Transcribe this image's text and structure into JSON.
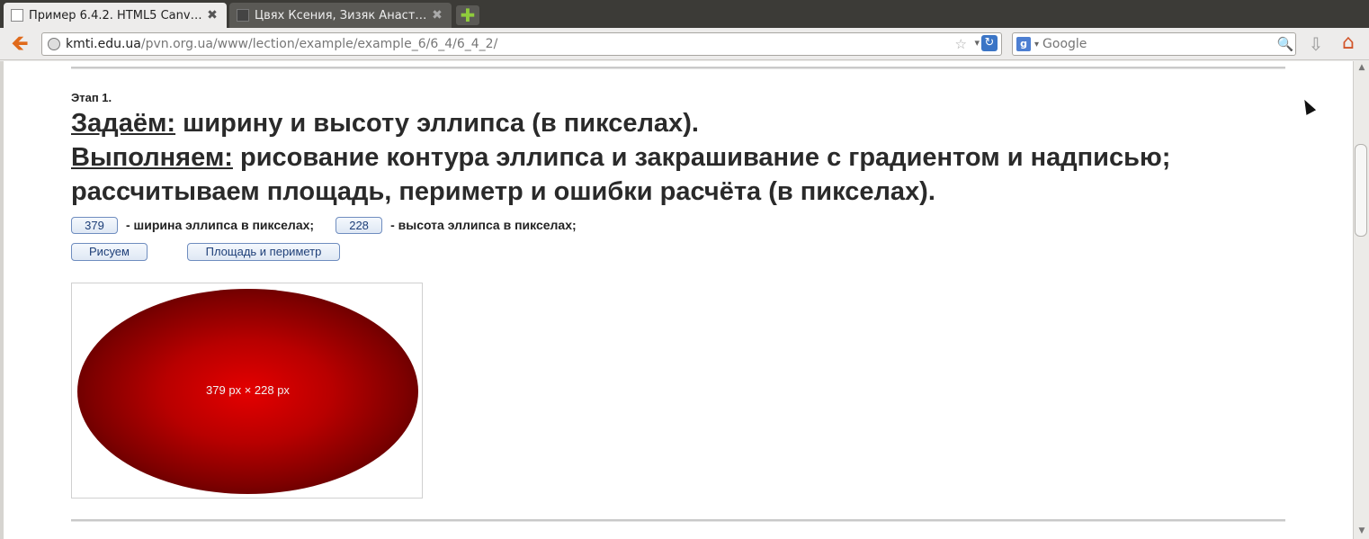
{
  "browser": {
    "tabs": [
      {
        "title": "Пример 6.4.2. HTML5 Canv…",
        "close": "✖"
      },
      {
        "title": "Цвях Ксения, Зизяк Анаст…",
        "close": "✖"
      }
    ],
    "new_tab": "✚",
    "back_icon": "🡸",
    "url": {
      "host": "kmti.edu.ua",
      "path": "/pvn.org.ua/www/lection/example/example_6/6_4/6_4_2/"
    },
    "bookmark_icon": "☆",
    "url_dropdown_icon": "▾",
    "reload_icon": "↻",
    "search": {
      "engine": "g",
      "engine_dropdown": "▾",
      "placeholder": "Google",
      "go_icon": "🔍"
    },
    "download_icon": "⇩",
    "home_icon": "⌂",
    "scroll_up": "▲",
    "scroll_down": "▼"
  },
  "page": {
    "stage": "Этап 1.",
    "set_keyword": "Задаём:",
    "set_text": " ширину и высоту эллипса (в пикселах).",
    "do_keyword": "Выполняем:",
    "do_text": " рисование контура эллипса и закрашивание с градиентом и надписью; рассчитываем площадь, периметр и ошибки расчёта (в пикселах).",
    "width_value": "379",
    "width_label": "- ширина эллипса в пикселах;",
    "height_value": "228",
    "height_label": "- высота эллипса в пикселах;",
    "draw_button": "Рисуем",
    "calc_button": "Площадь и периметр",
    "canvas_label": "379 px × 228 px"
  },
  "colors": {
    "ellipse_center": "#e40000",
    "ellipse_edge": "#2e0000",
    "button_text": "#1e3f78"
  }
}
